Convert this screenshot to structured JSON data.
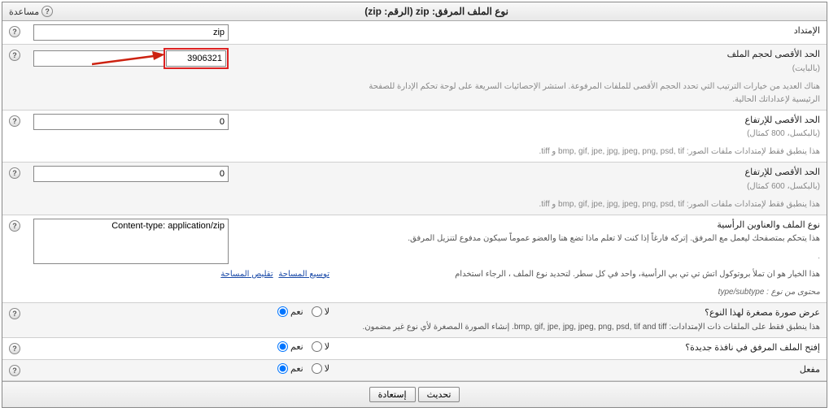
{
  "title_prefix": "نوع الملف المرفق:",
  "title_ext": "zip",
  "title_num_label": "(الرقم:",
  "title_num_val": "zip)",
  "help_label": "مساعدة",
  "rows": {
    "extension": {
      "label": "الإمتداد",
      "value": "zip"
    },
    "maxsize": {
      "label": "الحد الأقصى لحجم الملف",
      "sub": "(بالبايت)",
      "value": "3906321",
      "note": "هناك العديد من خيارات الترتيب التي تحدد الحجم الأقصى للملفات المرفوعة. استشر الإحصائيات السريعة على لوحة تحكم الإدارة للصفحة الرئيسية لإعداداتك الحالية."
    },
    "maxheight": {
      "label": "الحد الأقصى للإرتفاع",
      "sub": "(بالبكسل، 800 كمثال)",
      "value": "0",
      "note": "هذا ينطبق فقط لإمتدادات ملفات الصور: bmp, gif, jpe, jpg, jpeg, png, psd, tif و tiff."
    },
    "maxwidth": {
      "label": "الحد الأقصى للإرتفاع",
      "sub": "(بالبكسل، 600 كمثال)",
      "value": "0",
      "note": "هذا ينطبق فقط لإمتدادات ملفات الصور: bmp, gif, jpe, jpg, jpeg, png, psd, tif و tiff."
    },
    "mime": {
      "label": "نوع الملف والعناوين الرأسية",
      "desc": "هذا يتحكم بمتصفحك ليعمل مع المرفق. إتركه فارغاً إذا كنت لا تعلم ماذا تضع هنا والعضو عموماً سيكون مدفوع لتنزيل المرفق.",
      "desc2": "هذا الخيار هو ان تملأ بروتوكول اتش تي تي بي الرأسية، واحد في كل سطر. لتحديد نوع الملف ، الرجاء استخدام",
      "desc3": "محتوى من نوع : type/subtype",
      "value": "Content-type: application/zip",
      "expand": "توسيع المساحة",
      "collapse": "تقليص المساحة"
    },
    "thumb": {
      "label": "عرض صورة مصغرة لهذا النوع؟",
      "desc": "هذا ينطبق فقط على الملفات ذات الإمتدادات: bmp, gif, jpe, jpg, jpeg, png, psd, tif and tiff. إنشاء الصورة المصغرة لأي نوع غير مضمون."
    },
    "newwindow": {
      "label": "إفتح الملف المرفق في نافذة جديدة؟"
    },
    "enabled": {
      "label": "مفعل"
    }
  },
  "radio": {
    "yes": "نعم",
    "no": "لا"
  },
  "buttons": {
    "update": "تحديث",
    "reset": "إستعادة"
  }
}
